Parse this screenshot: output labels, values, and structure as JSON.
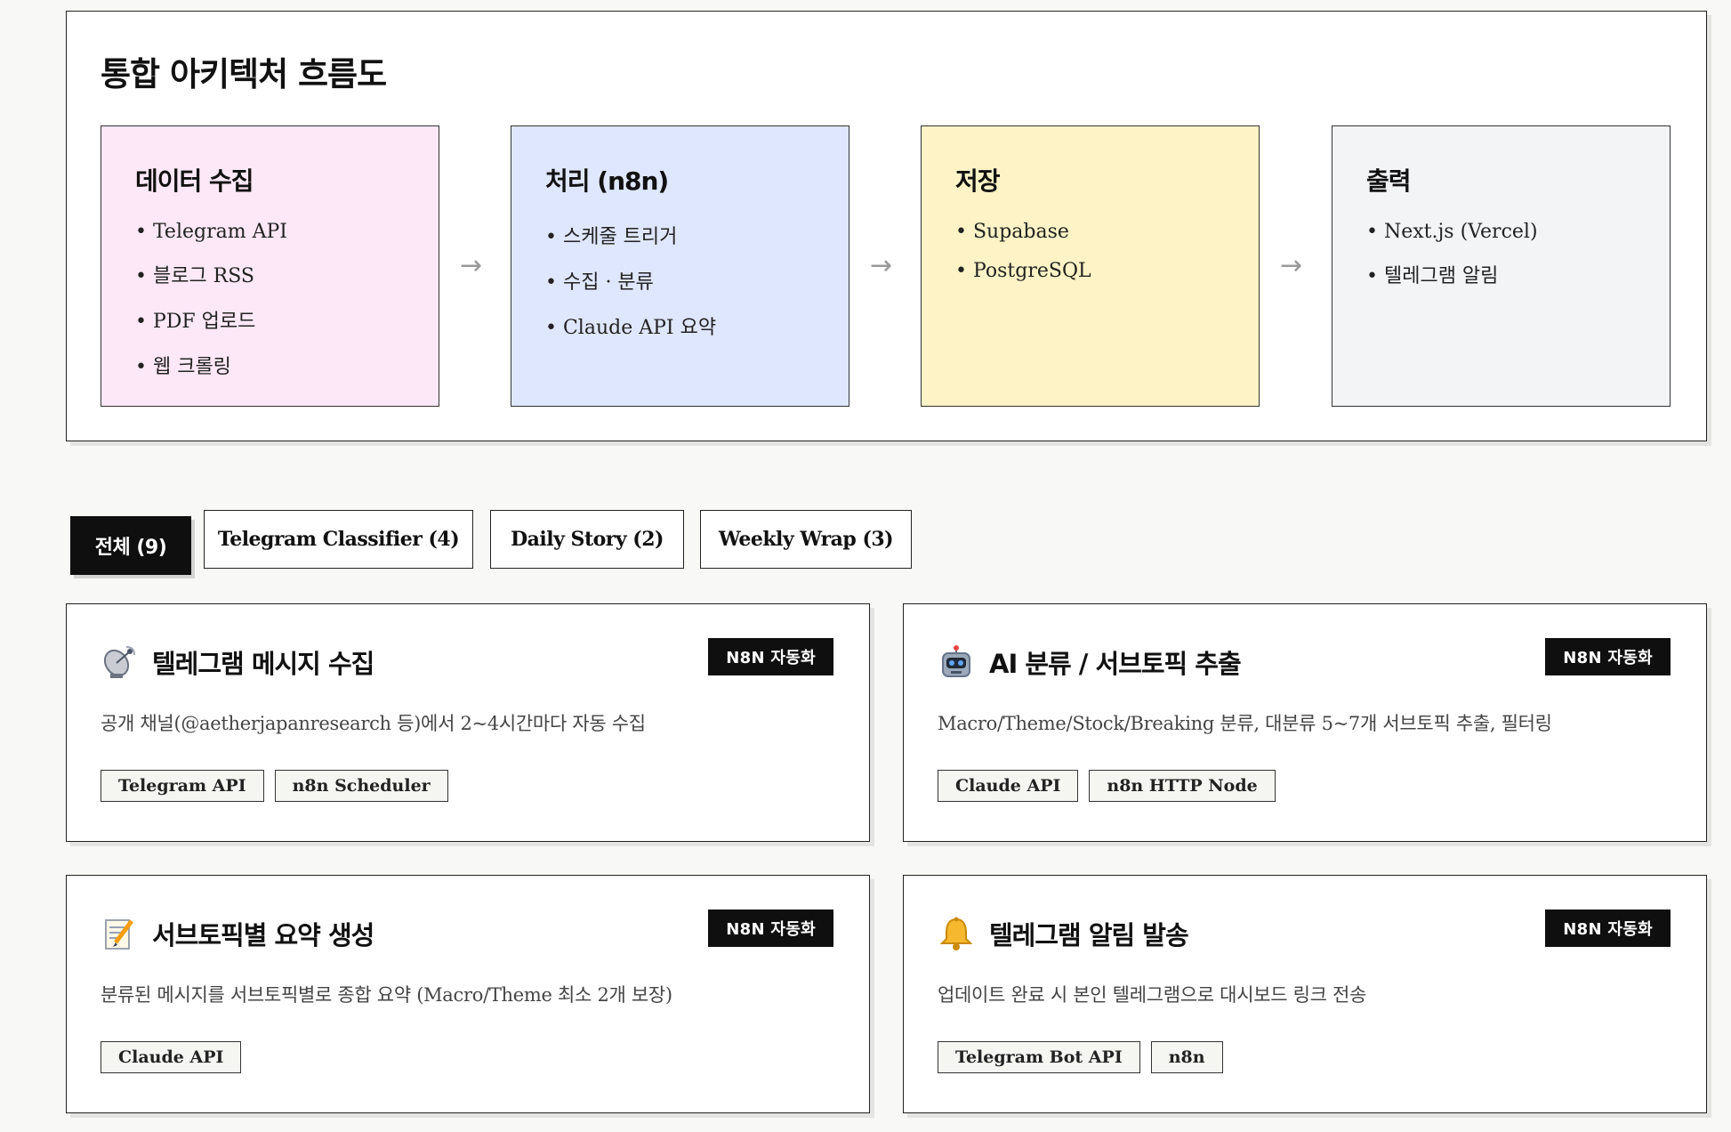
{
  "architecture": {
    "title": "통합 아키텍처 흐름도",
    "arrow": "→",
    "stages": [
      {
        "title": "데이터 수집",
        "color": "#fde8f7",
        "items": [
          "• Telegram API",
          "• 블로그 RSS",
          "• PDF 업로드",
          "• 웹 크롤링"
        ]
      },
      {
        "title": "처리 (n8n)",
        "color": "#dfe7fe",
        "items": [
          "• 스케줄 트리거",
          "• 수집 · 분류",
          "• Claude API 요약"
        ]
      },
      {
        "title": "저장",
        "color": "#fef3c6",
        "items": [
          "• Supabase",
          "• PostgreSQL"
        ]
      },
      {
        "title": "출력",
        "color": "#f3f4f6",
        "items": [
          "• Next.js (Vercel)",
          "• 텔레그램 알림"
        ]
      }
    ]
  },
  "tabs": [
    {
      "label": "전체 (9)",
      "active": true
    },
    {
      "label": "Telegram Classifier (4)",
      "active": false
    },
    {
      "label": "Daily Story (2)",
      "active": false
    },
    {
      "label": "Weekly Wrap (3)",
      "active": false
    }
  ],
  "cards": [
    {
      "icon": "satellite-dish-icon",
      "title": "텔레그램 메시지 수집",
      "badge": "N8N 자동화",
      "description": "공개 채널(@aetherjapanresearch 등)에서 2~4시간마다 자동 수집",
      "tags": [
        "Telegram API",
        "n8n Scheduler"
      ]
    },
    {
      "icon": "robot-icon",
      "title": "AI 분류 / 서브토픽 추출",
      "badge": "N8N 자동화",
      "description": "Macro/Theme/Stock/Breaking 분류, 대분류 5~7개 서브토픽 추출, 필터링",
      "tags": [
        "Claude API",
        "n8n HTTP Node"
      ]
    },
    {
      "icon": "memo-icon",
      "title": "서브토픽별 요약 생성",
      "badge": "N8N 자동화",
      "description": "분류된 메시지를 서브토픽별로 종합 요약 (Macro/Theme 최소 2개 보장)",
      "tags": [
        "Claude API"
      ]
    },
    {
      "icon": "bell-icon",
      "title": "텔레그램 알림 발송",
      "badge": "N8N 자동화",
      "description": "업데이트 완료 시 본인 텔레그램으로 대시보드 링크 전송",
      "tags": [
        "Telegram Bot API",
        "n8n"
      ]
    }
  ]
}
